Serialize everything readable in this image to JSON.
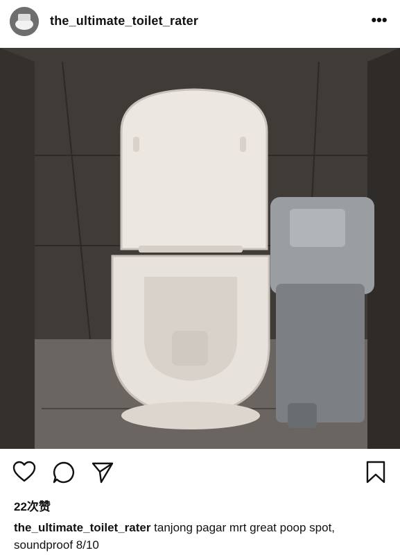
{
  "post": {
    "username": "the_ultimate_toilet_rater",
    "likes": "22次赞",
    "caption_user": "the_ultimate_toilet_rater",
    "caption_text": " tanjong pagar mrt great poop spot, soundproof 8/10",
    "more_label": "•••"
  },
  "icons": {
    "like": "heart-icon",
    "comment": "comment-icon",
    "share": "send-icon",
    "save": "bookmark-icon"
  },
  "colors": {
    "wall": "#3e3a36",
    "toilet": "#e9e4de",
    "bin": "#8c8f93"
  }
}
